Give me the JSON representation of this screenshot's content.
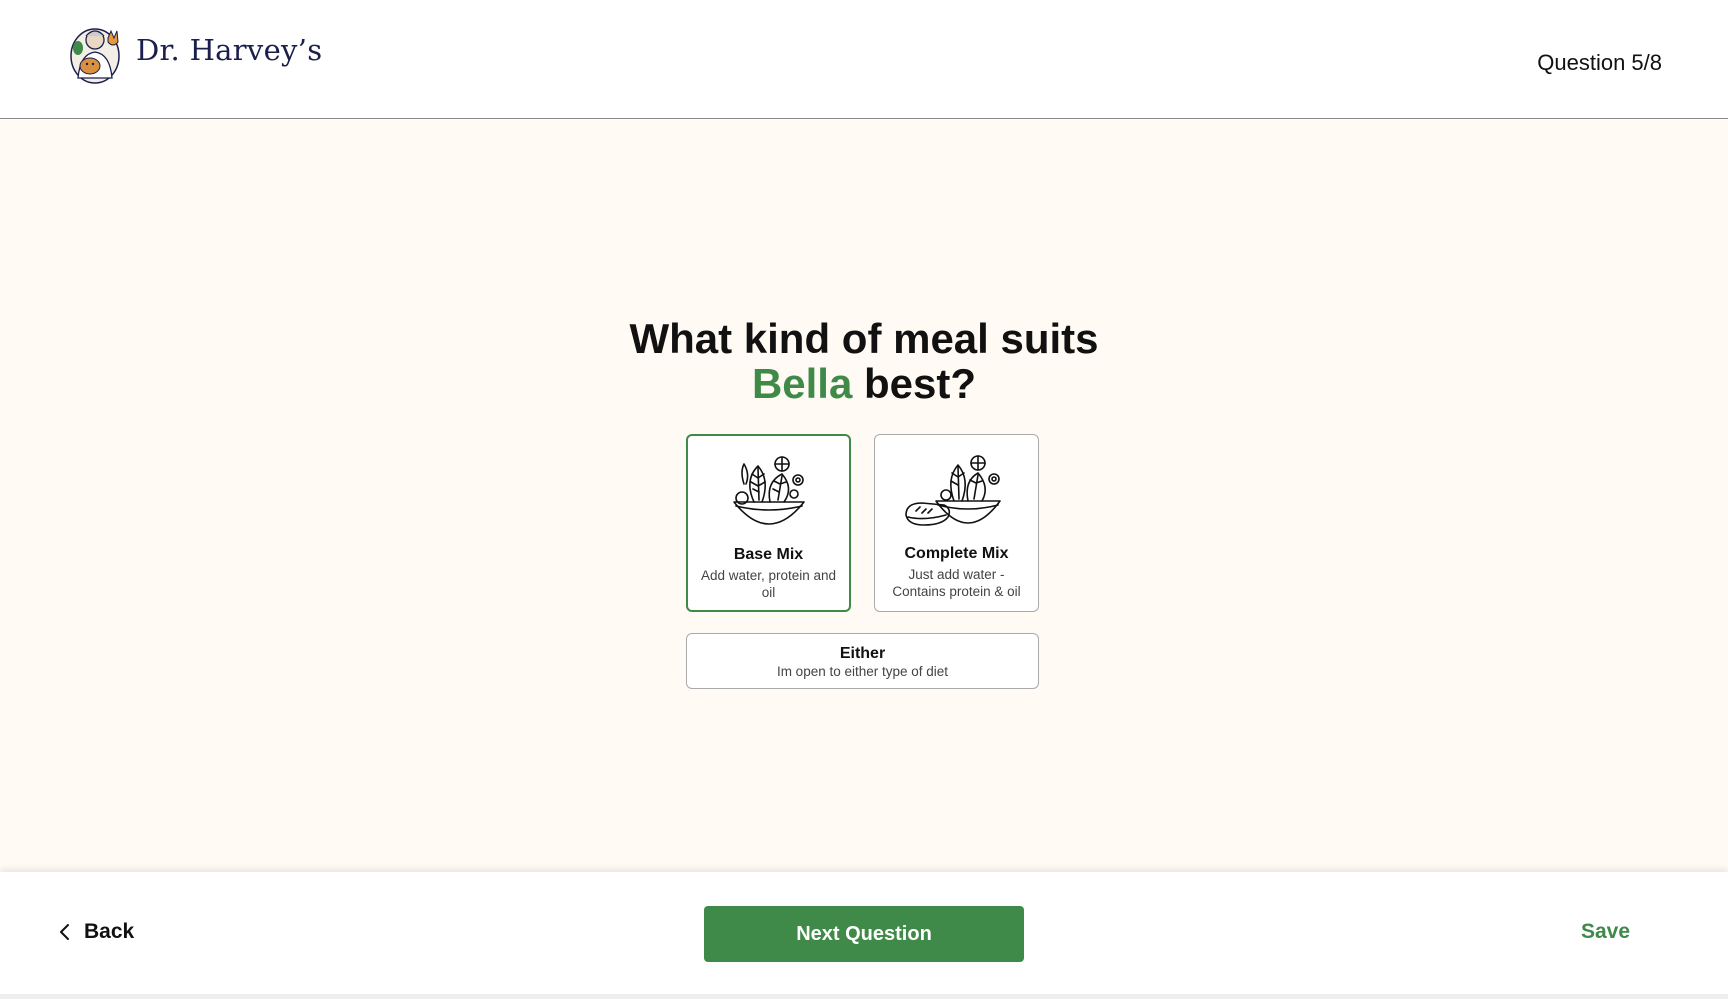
{
  "header": {
    "brand_name": "Dr. Harvey’s",
    "logo_icon": "doctor-with-pets-logo",
    "progress": "Question 5/8"
  },
  "question": {
    "prefix": "What kind of meal suits",
    "pet_name": "Bella",
    "suffix": "best?"
  },
  "options": [
    {
      "title": "Base Mix",
      "description": "Add water, protein and oil",
      "icon": "veggie-bowl-icon",
      "selected": true
    },
    {
      "title": "Complete Mix",
      "description": "Just add water - Contains protein & oil",
      "icon": "veggie-bowl-with-meat-icon",
      "selected": false
    },
    {
      "title": "Either",
      "description": "Im open to either type of diet",
      "selected": false
    }
  ],
  "footer": {
    "back_label": "Back",
    "next_label": "Next Question",
    "save_label": "Save"
  },
  "colors": {
    "brand_green": "#3f8a48",
    "brand_navy": "#1a1f4b",
    "background_cream": "#fffaf3"
  }
}
